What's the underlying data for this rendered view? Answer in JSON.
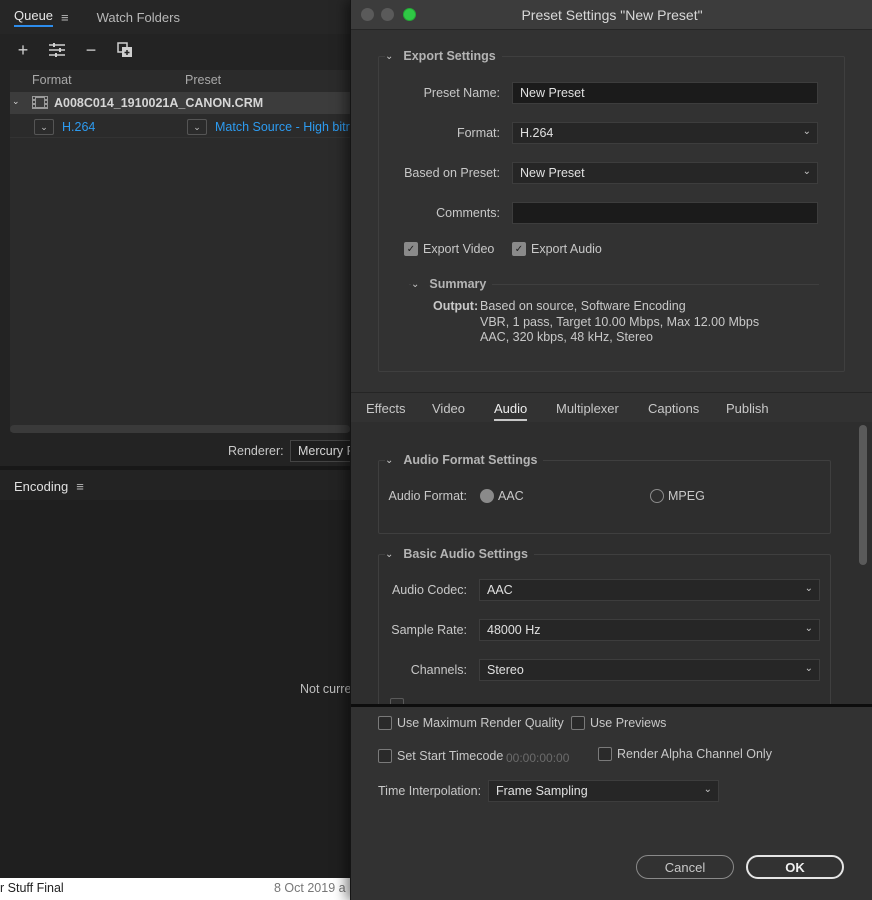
{
  "queue_panel": {
    "tabs": [
      {
        "label": "Queue",
        "active": true
      },
      {
        "label": "Watch Folders",
        "active": false
      }
    ],
    "menu_glyph": "≡",
    "toolbar": {
      "add": "+",
      "settings": "⚌",
      "remove": "−",
      "duplicate": "⧉"
    },
    "columns": {
      "format": "Format",
      "preset": "Preset"
    },
    "file_name": "A008C014_1910021A_CANON.CRM",
    "output_format": "H.264",
    "output_preset": "Match Source - High bitra",
    "renderer_label": "Renderer:",
    "renderer_value": "Mercury P"
  },
  "encoding_panel": {
    "title": "Encoding",
    "menu_glyph": "≡",
    "status_text": "Not curre"
  },
  "finder_strip": {
    "name": "r Stuff Final",
    "date": "8 Oct 2019 a"
  },
  "dialog": {
    "title": "Preset Settings \"New Preset\"",
    "export_settings": {
      "heading": "Export Settings",
      "preset_name_label": "Preset Name:",
      "preset_name_value": "New Preset",
      "format_label": "Format:",
      "format_value": "H.264",
      "based_on_label": "Based on Preset:",
      "based_on_value": "New Preset",
      "comments_label": "Comments:",
      "comments_value": "",
      "export_video_label": "Export Video",
      "export_video_checked": true,
      "export_audio_label": "Export Audio",
      "export_audio_checked": true,
      "summary_heading": "Summary",
      "output_label": "Output:",
      "output_lines": [
        "Based on source, Software Encoding",
        "VBR, 1 pass, Target 10.00 Mbps, Max 12.00 Mbps",
        "AAC, 320 kbps, 48 kHz, Stereo"
      ]
    },
    "tabs": [
      {
        "label": "Effects",
        "active": false
      },
      {
        "label": "Video",
        "active": false
      },
      {
        "label": "Audio",
        "active": true
      },
      {
        "label": "Multiplexer",
        "active": false
      },
      {
        "label": "Captions",
        "active": false
      },
      {
        "label": "Publish",
        "active": false
      }
    ],
    "audio_format_settings": {
      "heading": "Audio Format Settings",
      "label": "Audio Format:",
      "options": [
        {
          "label": "AAC",
          "selected": true
        },
        {
          "label": "MPEG",
          "selected": false
        }
      ]
    },
    "basic_audio_settings": {
      "heading": "Basic Audio Settings",
      "codec_label": "Audio Codec:",
      "codec_value": "AAC",
      "sample_rate_label": "Sample Rate:",
      "sample_rate_value": "48000 Hz",
      "channels_label": "Channels:",
      "channels_value": "Stereo"
    },
    "bottom_options": {
      "max_render_quality": "Use Maximum Render Quality",
      "use_previews": "Use Previews",
      "set_start_timecode": "Set Start Timecode",
      "timecode_value": "00:00:00:00",
      "render_alpha": "Render Alpha Channel Only",
      "time_interp_label": "Time Interpolation:",
      "time_interp_value": "Frame Sampling"
    },
    "buttons": {
      "cancel": "Cancel",
      "ok": "OK"
    }
  },
  "colors": {
    "accent_blue": "#2d9bf0",
    "traffic_green": "#2fc845",
    "panel_bg": "#323232"
  }
}
